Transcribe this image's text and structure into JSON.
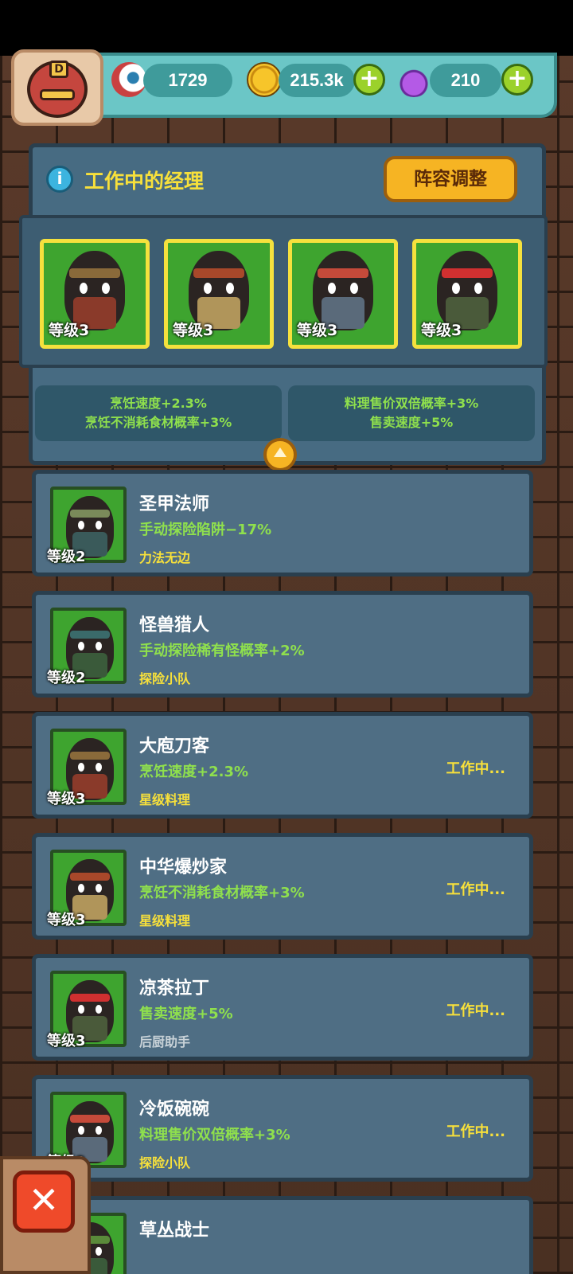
{
  "resources": {
    "eyeballs": "1729",
    "coins": "215.3k",
    "potions": "210"
  },
  "avatar": {
    "badge": "D"
  },
  "panel": {
    "title": "工作中的经理",
    "team_button": "阵容调整"
  },
  "active_managers": [
    {
      "level": "等级3",
      "band": "#8a6a3a",
      "body": "#8a3a2a"
    },
    {
      "level": "等级3",
      "band": "#a8482a",
      "body": "#b0955a"
    },
    {
      "level": "等级3",
      "band": "#c54a3a",
      "body": "#5a6a7a"
    },
    {
      "level": "等级3",
      "band": "#d03030",
      "body": "#4a5a3a"
    }
  ],
  "bonuses": [
    {
      "line1": "烹饪速度+2.3%",
      "line2": "烹饪不消耗食材概率+3%"
    },
    {
      "line1": "料理售价双倍概率+3%",
      "line2": "售卖速度+5%"
    }
  ],
  "managers": [
    {
      "name": "圣甲法师",
      "level": "等级2",
      "effect": "手动探险陷阱−17%",
      "tag": "力法无边",
      "tag_color": "#f7e03b",
      "working": "",
      "band": "#7a8a5a",
      "body": "#3a5a5a"
    },
    {
      "name": "怪兽猎人",
      "level": "等级2",
      "effect": "手动探险稀有怪概率+2%",
      "tag": "探险小队",
      "tag_color": "#f7e03b",
      "working": "",
      "band": "#3a6a6a",
      "body": "#3a5a3a"
    },
    {
      "name": "大庖刀客",
      "level": "等级3",
      "effect": "烹饪速度+2.3%",
      "tag": "星级料理",
      "tag_color": "#f7e03b",
      "working": "工作中...",
      "band": "#8a6a3a",
      "body": "#8a3a2a"
    },
    {
      "name": "中华爆炒家",
      "level": "等级3",
      "effect": "烹饪不消耗食材概率+3%",
      "tag": "星级料理",
      "tag_color": "#f7e03b",
      "working": "工作中...",
      "band": "#a8482a",
      "body": "#b0955a"
    },
    {
      "name": "凉茶拉丁",
      "level": "等级3",
      "effect": "售卖速度+5%",
      "tag": "后厨助手",
      "tag_color": "#c8d2d8",
      "working": "工作中...",
      "band": "#d03030",
      "body": "#4a5a3a"
    },
    {
      "name": "冷饭碗碗",
      "level": "等级3",
      "effect": "料理售价双倍概率+3%",
      "tag": "探险小队",
      "tag_color": "#f7e03b",
      "working": "工作中...",
      "band": "#c54a3a",
      "body": "#5a6a7a"
    },
    {
      "name": "草丛战士",
      "level": "",
      "effect": "",
      "tag": "",
      "tag_color": "#f7e03b",
      "working": "",
      "band": "#5a8a3a",
      "body": "#3a5a3a"
    }
  ],
  "close_button": "✕",
  "plus_label": "+"
}
